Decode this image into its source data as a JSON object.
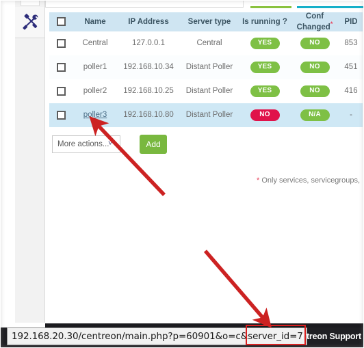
{
  "sidebar": {
    "tools_icon": "tools-wrench-screwdriver-icon"
  },
  "tabs": [
    {
      "name": "tab-stub-inactive",
      "underline_color": "#cfcfcf"
    },
    {
      "name": "tab-stub-green",
      "underline_color": "#8ac23e"
    },
    {
      "name": "tab-stub-teal",
      "underline_color": "#16b0c9"
    }
  ],
  "table": {
    "columns": [
      {
        "key": "checkbox",
        "label": ""
      },
      {
        "key": "name",
        "label": "Name"
      },
      {
        "key": "ip",
        "label": "IP Address"
      },
      {
        "key": "type",
        "label": "Server type"
      },
      {
        "key": "running",
        "label": "Is running ?"
      },
      {
        "key": "conf",
        "label": "Conf Changed"
      },
      {
        "key": "pid",
        "label": "PID"
      }
    ],
    "conf_asterisk": "*",
    "rows": [
      {
        "name": "Central",
        "ip": "127.0.0.1",
        "type": "Central",
        "running": "YES",
        "running_color": "green",
        "conf": "NO",
        "conf_color": "green",
        "pid": "853",
        "selected": false,
        "link": false
      },
      {
        "name": "poller1",
        "ip": "192.168.10.34",
        "type": "Distant Poller",
        "running": "YES",
        "running_color": "green",
        "conf": "NO",
        "conf_color": "green",
        "pid": "451",
        "selected": false,
        "link": false
      },
      {
        "name": "poller2",
        "ip": "192.168.10.25",
        "type": "Distant Poller",
        "running": "YES",
        "running_color": "green",
        "conf": "NO",
        "conf_color": "green",
        "pid": "416",
        "selected": false,
        "link": false
      },
      {
        "name": "poller3",
        "ip": "192.168.10.80",
        "type": "Distant Poller",
        "running": "NO",
        "running_color": "red",
        "conf": "N/A",
        "conf_color": "green",
        "pid": "-",
        "selected": true,
        "link": true
      }
    ]
  },
  "actions": {
    "more_actions_label": "More actions...",
    "more_actions_caret": "chevron-down-icon",
    "add_label": "Add"
  },
  "footnote": {
    "star": "*",
    "text": " Only services, servicegroups,"
  },
  "statusbar": {
    "url_prefix": "192.168.20.30/centreon/main.php?p=60901&o=c&",
    "url_highlight": "server_id=7",
    "support_tag": "ntreon Support"
  },
  "annotations": {
    "arrow1_target": "poller3-name-cell",
    "arrow2_target": "url-server-id-highlight",
    "arrow_color": "#cc2222",
    "highlight_box_color": "#d81f1f"
  }
}
